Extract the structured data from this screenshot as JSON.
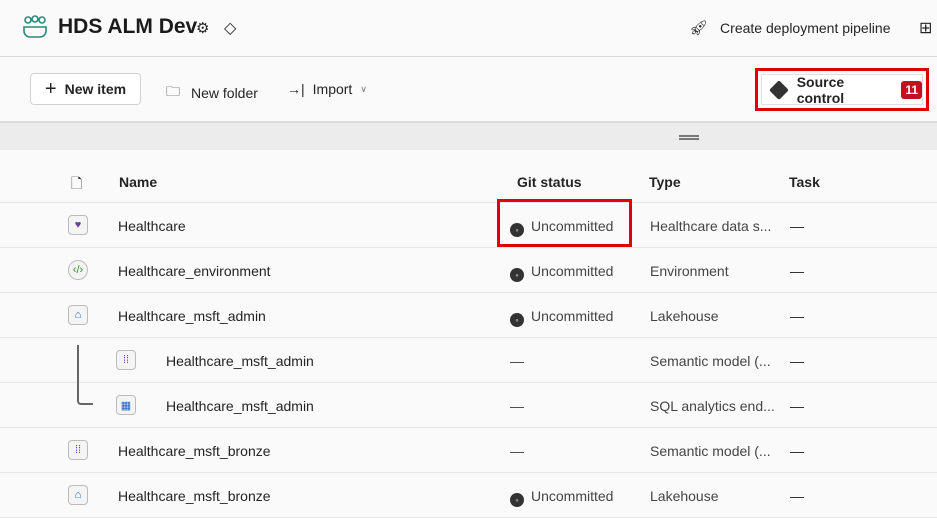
{
  "workspace": {
    "title": "HDS ALM Dev"
  },
  "header": {
    "deploy_label": "Create deployment pipeline"
  },
  "toolbar": {
    "new_item": "New item",
    "new_folder": "New folder",
    "import": "Import",
    "source_control": "Source control",
    "source_control_count": "11"
  },
  "table": {
    "columns": {
      "name": "Name",
      "git": "Git status",
      "type": "Type",
      "task": "Task"
    },
    "rows": [
      {
        "name": "Healthcare",
        "git": "Uncommitted",
        "type": "Healthcare data s...",
        "task": "—",
        "icon": "healthcare-data-solution-icon"
      },
      {
        "name": "Healthcare_environment",
        "git": "Uncommitted",
        "type": "Environment",
        "task": "—",
        "icon": "environment-icon"
      },
      {
        "name": "Healthcare_msft_admin",
        "git": "Uncommitted",
        "type": "Lakehouse",
        "task": "—",
        "icon": "lakehouse-icon"
      },
      {
        "name": "Healthcare_msft_admin",
        "git": "—",
        "type": "Semantic model (...",
        "task": "—",
        "icon": "semantic-model-icon"
      },
      {
        "name": "Healthcare_msft_admin",
        "git": "—",
        "type": "SQL analytics end...",
        "task": "—",
        "icon": "sql-endpoint-icon"
      },
      {
        "name": "Healthcare_msft_bronze",
        "git": "—",
        "type": "Semantic model (...",
        "task": "—",
        "icon": "semantic-model-icon"
      },
      {
        "name": "Healthcare_msft_bronze",
        "git": "Uncommitted",
        "type": "Lakehouse",
        "task": "—",
        "icon": "lakehouse-icon"
      }
    ]
  }
}
